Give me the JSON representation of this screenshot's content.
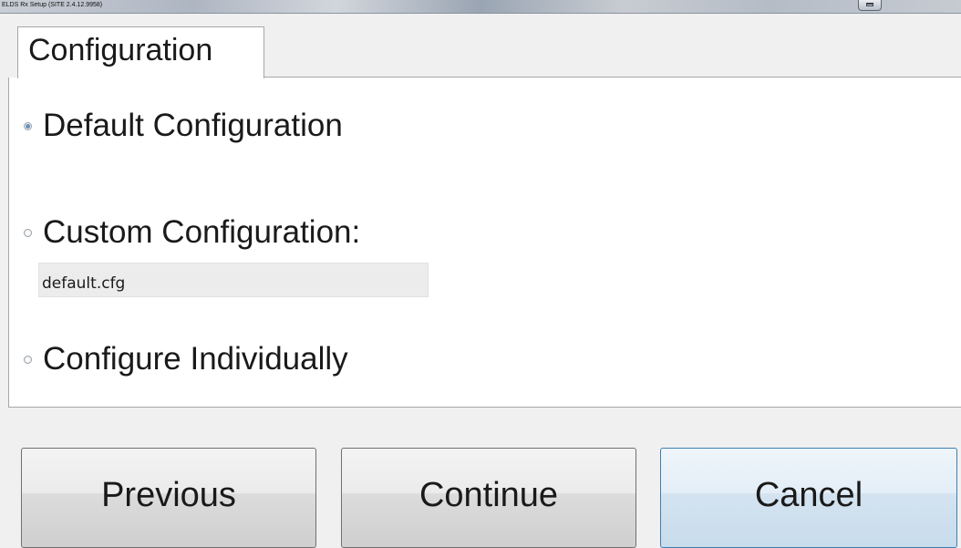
{
  "window": {
    "title": "ELDS Rx Setup (SITE 2.4.12.9958)"
  },
  "tab": {
    "label": "Configuration"
  },
  "options": [
    {
      "label": "Default Configuration",
      "checked": true
    },
    {
      "label": "Custom Configuration:",
      "checked": false
    },
    {
      "label": "Configure Individually",
      "checked": false
    }
  ],
  "custom_config": {
    "value": "default.cfg"
  },
  "buttons": {
    "previous": "Previous",
    "continue": "Continue",
    "cancel": "Cancel"
  },
  "colors": {
    "focus_border": "#3c7fb1",
    "radio_selected": "#3e6d9e"
  }
}
